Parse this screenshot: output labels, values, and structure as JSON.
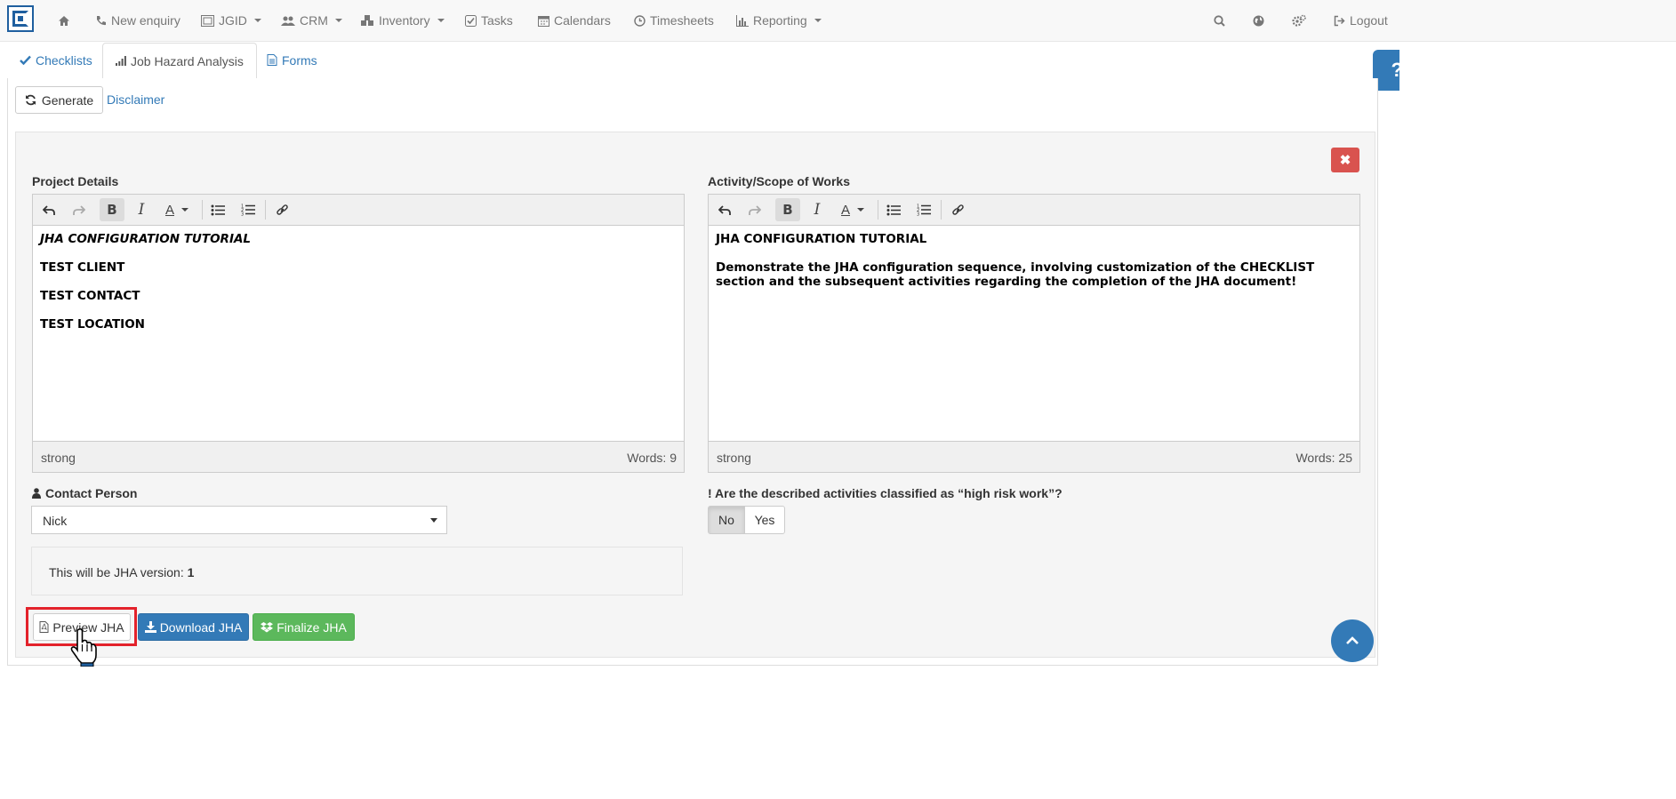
{
  "nav": {
    "items": [
      {
        "icon": "home-icon",
        "label": ""
      },
      {
        "icon": "phone-icon",
        "label": "New enquiry"
      },
      {
        "icon": "id-card-icon",
        "label": "JGID"
      },
      {
        "icon": "users-icon",
        "label": "CRM"
      },
      {
        "icon": "cubes-icon",
        "label": "Inventory"
      },
      {
        "icon": "check-square-icon",
        "label": "Tasks"
      },
      {
        "icon": "calendar-icon",
        "label": "Calendars"
      },
      {
        "icon": "clock-icon",
        "label": "Timesheets"
      },
      {
        "icon": "bar-chart-icon",
        "label": "Reporting"
      }
    ],
    "right": {
      "search_icon": "search-icon",
      "globe_icon": "globe-icon",
      "settings_icon": "cogs-icon",
      "logout_label": "Logout"
    }
  },
  "tabs": [
    {
      "icon": "check-icon",
      "label": "Checklists"
    },
    {
      "icon": "signal-icon",
      "label": "Job Hazard Analysis"
    },
    {
      "icon": "file-text-icon",
      "label": "Forms"
    }
  ],
  "help_label": "?",
  "actions": {
    "generate_label": "Generate",
    "disclaimer_label": "Disclaimer",
    "close_label": "✖"
  },
  "project_details": {
    "label": "Project Details",
    "lines": [
      "JHA CONFIGURATION TUTORIAL",
      "TEST CLIENT",
      "TEST CONTACT",
      "TEST LOCATION"
    ],
    "status_path": "strong",
    "word_count": "Words: 9"
  },
  "activity_scope": {
    "label": "Activity/Scope of Works",
    "line1": "JHA CONFIGURATION TUTORIAL",
    "line2": "Demonstrate the JHA configuration sequence, involving customization of the CHECKLIST section and the subsequent activities regarding the completion of the JHA document!",
    "status_path": "strong",
    "word_count": "Words: 25"
  },
  "contact": {
    "label": "Contact Person",
    "value": "Nick"
  },
  "high_risk": {
    "label": "Are the described activities classified as “high risk work”?",
    "options": [
      "No",
      "Yes"
    ],
    "selected": "No"
  },
  "version": {
    "text": "This will be JHA version: ",
    "number": "1"
  },
  "buttons": {
    "preview": "Preview JHA",
    "download": "Download JHA",
    "finalize": "Finalize JHA"
  },
  "colors": {
    "primary": "#337ab7",
    "success": "#5cb85c",
    "danger": "#d9534f",
    "highlight": "#e3222b"
  }
}
